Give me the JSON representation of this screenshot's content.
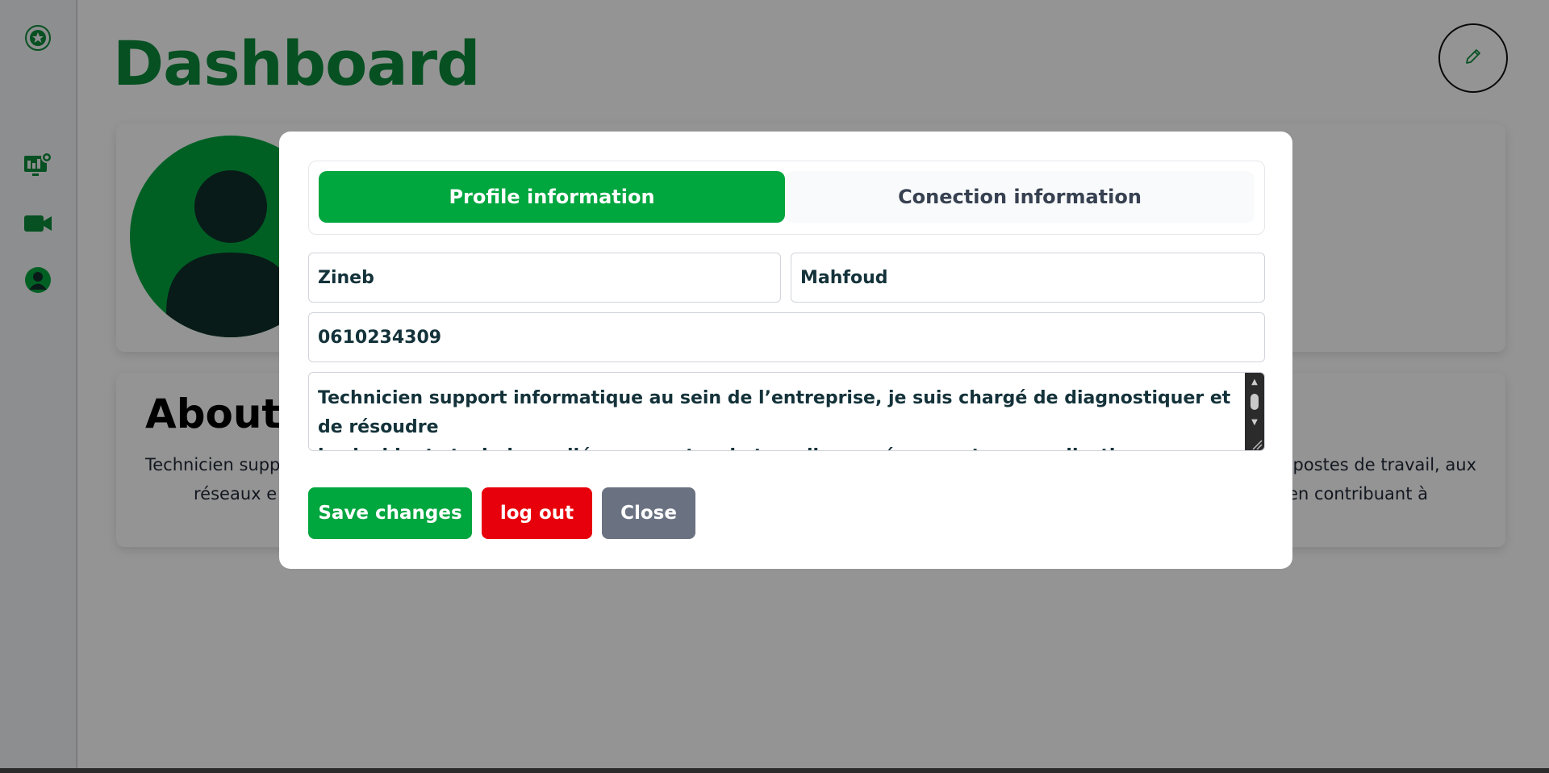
{
  "app": {
    "page_title": "Dashboard",
    "edit_icon": "pencil-icon"
  },
  "sidebar": {
    "items": [
      {
        "icon": "logo-emblem-icon"
      },
      {
        "icon": "monitor-dashboard-icon"
      },
      {
        "icon": "video-camera-icon"
      },
      {
        "icon": "user-profile-icon"
      }
    ]
  },
  "about": {
    "title": "About",
    "text_left": "Technicien supp",
    "text_left_2": "réseaux e",
    "text_right": "x postes de travail, aux",
    "text_right_2": "en contribuant à"
  },
  "modal": {
    "tabs": [
      {
        "label": "Profile information",
        "active": true
      },
      {
        "label": "Conection information",
        "active": false
      }
    ],
    "form": {
      "first_name": "Zineb",
      "last_name": "Mahfoud",
      "phone": "0610234309",
      "bio_line1": "Technicien support informatique au sein de l’entreprise, je suis chargé de diagnostiquer et de résoudre",
      "bio_line2": "les incidents techniques liés aux postes de travail, aux réseaux et aux applications internes."
    },
    "buttons": {
      "save": "Save changes",
      "logout": "log out",
      "close": "Close"
    }
  },
  "colors": {
    "brand_green": "#00a63e",
    "title_green": "#0b8a3a",
    "danger_red": "#e7000b",
    "neutral_gray": "#6a7282"
  }
}
